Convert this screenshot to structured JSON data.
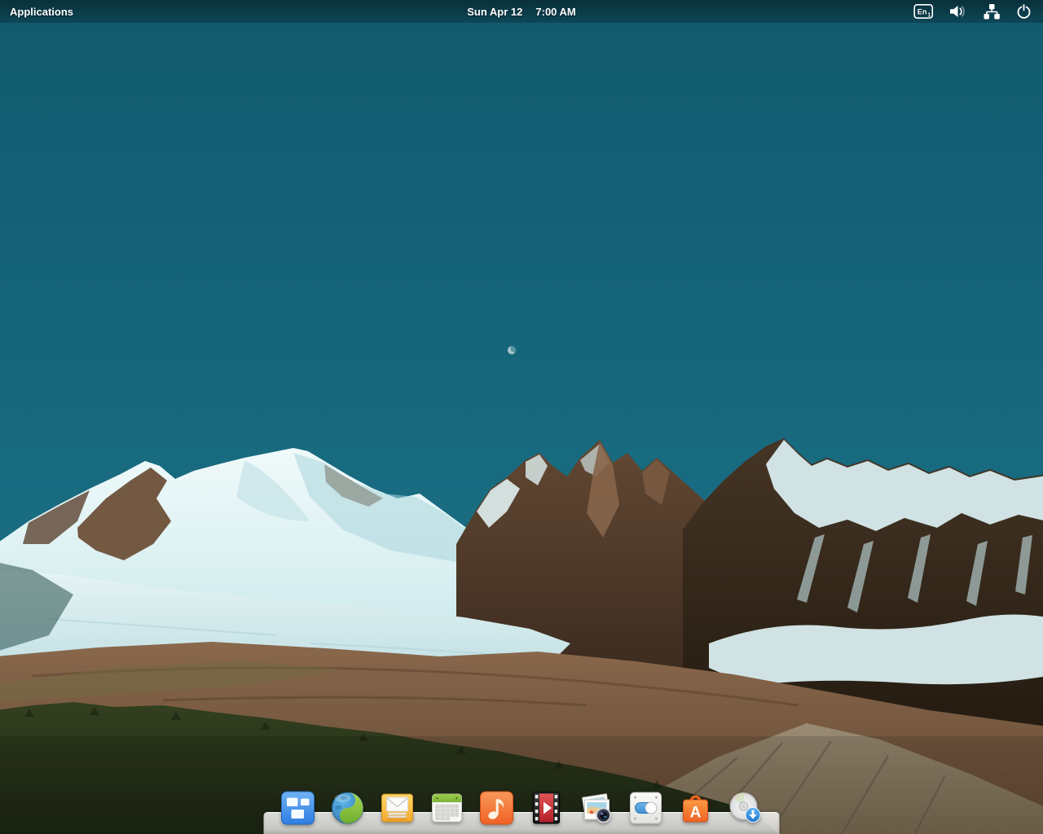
{
  "panel": {
    "applications_label": "Applications",
    "clock": {
      "date": "Sun Apr 12",
      "time": "7:00 AM"
    },
    "keyboard_layout": {
      "code": "En",
      "index": "1"
    },
    "indicators": [
      {
        "name": "keyboard-layout-indicator"
      },
      {
        "name": "sound-indicator"
      },
      {
        "name": "network-indicator"
      },
      {
        "name": "session-indicator"
      }
    ]
  },
  "desktop": {
    "wallpaper": {
      "description": "Snow-capped mountain range with glacier, brown foothills and pine forest under a teal sky with a small moon",
      "palette": {
        "sky": "#15647a",
        "snow": "#e7f5f5",
        "snow_shadow": "#a9d6dc",
        "rock_brown": "#6d5038",
        "rock_dark": "#2f2417",
        "foothill": "#82614a",
        "scree": "#8f8169",
        "forest": "#2c3820"
      }
    }
  },
  "dock": {
    "items": [
      {
        "name": "multitasking-view",
        "accent": "#3689e6"
      },
      {
        "name": "web-browser",
        "accent": "#68b723"
      },
      {
        "name": "mail",
        "accent": "#f9c440"
      },
      {
        "name": "calendar",
        "accent": "#8bc34a"
      },
      {
        "name": "music",
        "accent": "#f37329"
      },
      {
        "name": "videos",
        "accent": "#c6262e"
      },
      {
        "name": "photos",
        "accent": "#e2c49a"
      },
      {
        "name": "system-settings",
        "accent": "#64baff"
      },
      {
        "name": "appcenter",
        "accent": "#f37329",
        "glyph": "A"
      },
      {
        "name": "os-installer",
        "accent": "#3689e6"
      }
    ]
  }
}
